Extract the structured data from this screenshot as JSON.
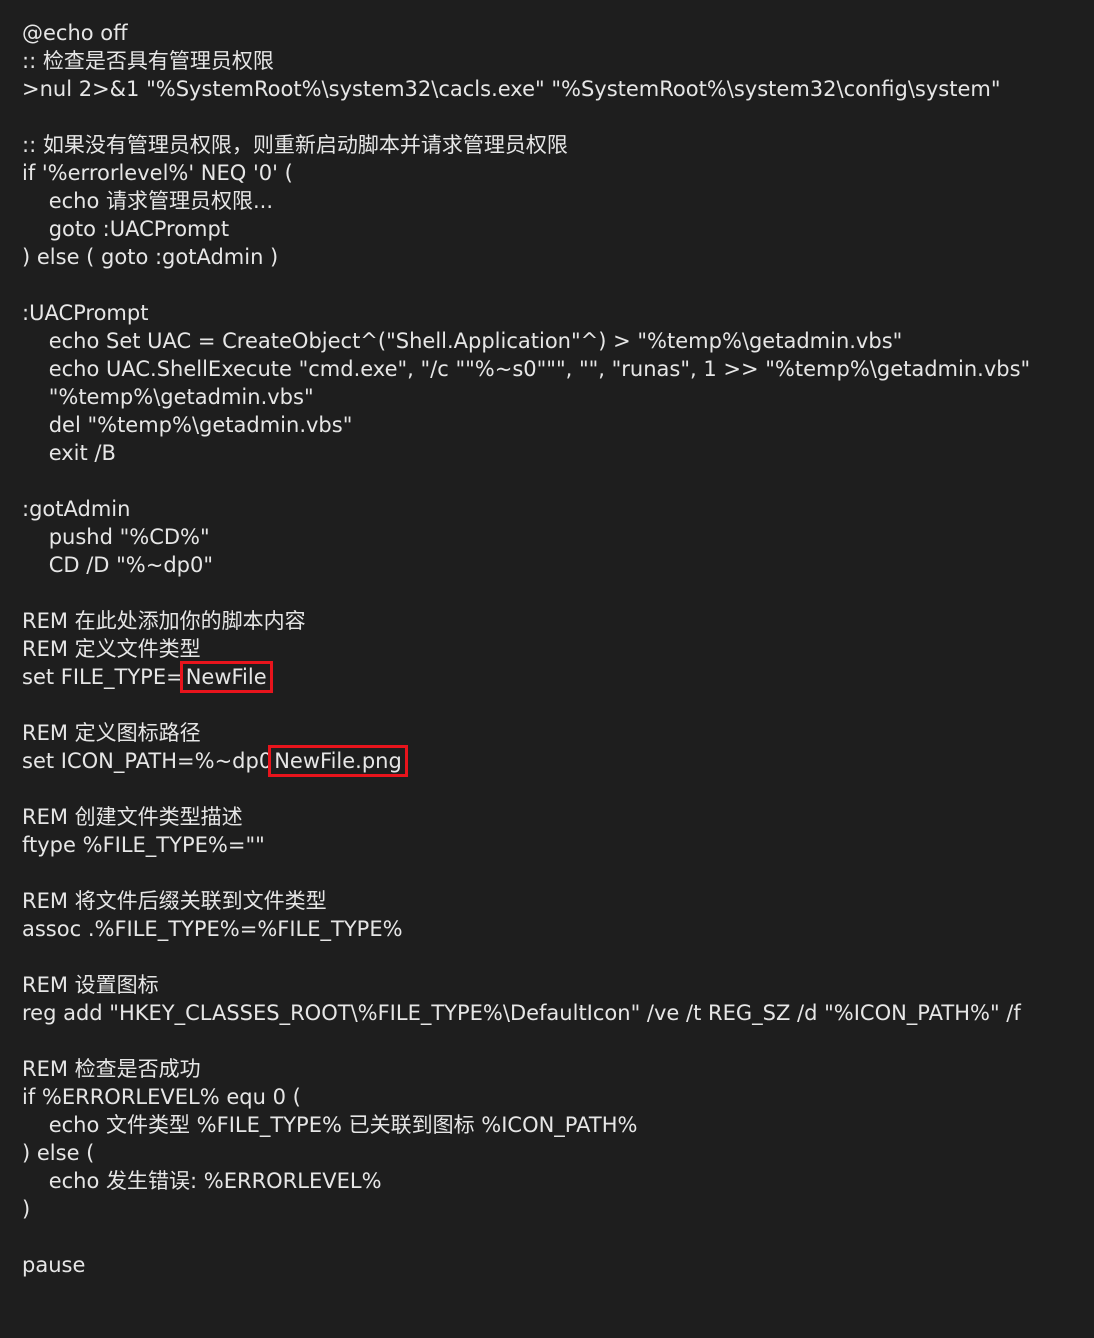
{
  "editor": {
    "background": "#1e1e1e",
    "text_color": "#e6e6e6",
    "highlight_color": "#e8141c",
    "lines": [
      "@echo off",
      ":: 检查是否具有管理员权限",
      ">nul 2>&1 \"%SystemRoot%\\system32\\cacls.exe\" \"%SystemRoot%\\system32\\config\\system\"",
      "",
      ":: 如果没有管理员权限，则重新启动脚本并请求管理员权限",
      "if '%errorlevel%' NEQ '0' (",
      "    echo 请求管理员权限...",
      "    goto :UACPrompt",
      ") else ( goto :gotAdmin )",
      "",
      ":UACPrompt",
      "    echo Set UAC = CreateObject^(\"Shell.Application\"^) > \"%temp%\\getadmin.vbs\"",
      "    echo UAC.ShellExecute \"cmd.exe\", \"/c \"\"%~s0\"\"\", \"\", \"runas\", 1 >> \"%temp%\\getadmin.vbs\"",
      "    \"%temp%\\getadmin.vbs\"",
      "    del \"%temp%\\getadmin.vbs\"",
      "    exit /B",
      "",
      ":gotAdmin",
      "    pushd \"%CD%\"",
      "    CD /D \"%~dp0\"",
      "",
      "REM 在此处添加你的脚本内容",
      "REM 定义文件类型",
      "set FILE_TYPE=NewFile",
      "",
      "REM 定义图标路径",
      "set ICON_PATH=%~dp0NewFile.png",
      "",
      "REM 创建文件类型描述",
      "ftype %FILE_TYPE%=\"\"",
      "",
      "REM 将文件后缀关联到文件类型",
      "assoc .%FILE_TYPE%=%FILE_TYPE%",
      "",
      "REM 设置图标",
      "reg add \"HKEY_CLASSES_ROOT\\%FILE_TYPE%\\DefaultIcon\" /ve /t REG_SZ /d \"%ICON_PATH%\" /f",
      "",
      "REM 检查是否成功",
      "if %ERRORLEVEL% equ 0 (",
      "    echo 文件类型 %FILE_TYPE% 已关联到图标 %ICON_PATH%",
      ") else (",
      "    echo 发生错误: %ERRORLEVEL%",
      ")",
      "",
      "pause"
    ],
    "highlighted_line_indices": [
      23,
      26
    ],
    "highlights": [
      {
        "line": 23,
        "text": "NewFile"
      },
      {
        "line": 26,
        "text": "NewFile.png"
      }
    ]
  }
}
